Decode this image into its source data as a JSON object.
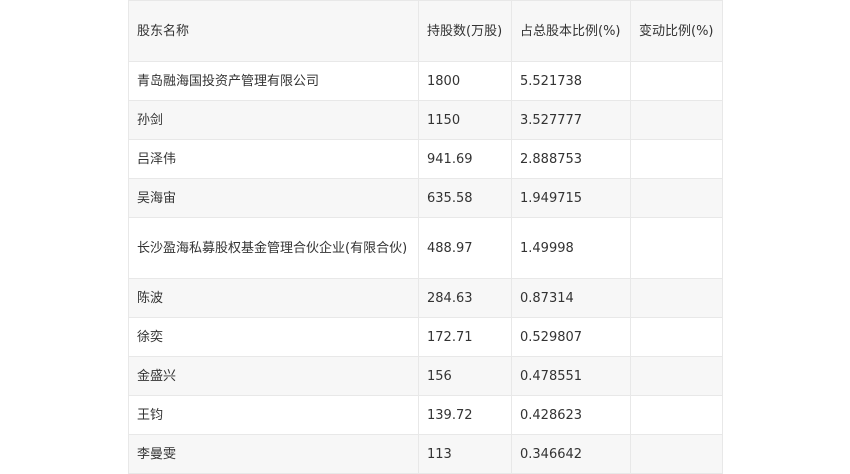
{
  "table": {
    "headers": [
      "股东名称",
      "持股数(万股)",
      "占总股本比例(%)",
      "变动比例(%)"
    ],
    "rows": [
      {
        "name": "青岛融海国投资产管理有限公司",
        "shares": "1800",
        "ratio": "5.521738",
        "change": ""
      },
      {
        "name": "孙剑",
        "shares": "1150",
        "ratio": "3.527777",
        "change": ""
      },
      {
        "name": "吕泽伟",
        "shares": "941.69",
        "ratio": "2.888753",
        "change": ""
      },
      {
        "name": "吴海宙",
        "shares": "635.58",
        "ratio": "1.949715",
        "change": ""
      },
      {
        "name": "长沙盈海私募股权基金管理合伙企业(有限合伙)",
        "shares": "488.97",
        "ratio": "1.49998",
        "change": ""
      },
      {
        "name": "陈波",
        "shares": "284.63",
        "ratio": "0.87314",
        "change": ""
      },
      {
        "name": "徐奕",
        "shares": "172.71",
        "ratio": "0.529807",
        "change": ""
      },
      {
        "name": "金盛兴",
        "shares": "156",
        "ratio": "0.478551",
        "change": ""
      },
      {
        "name": "王钧",
        "shares": "139.72",
        "ratio": "0.428623",
        "change": ""
      },
      {
        "name": "李曼雯",
        "shares": "113",
        "ratio": "0.346642",
        "change": ""
      }
    ]
  }
}
